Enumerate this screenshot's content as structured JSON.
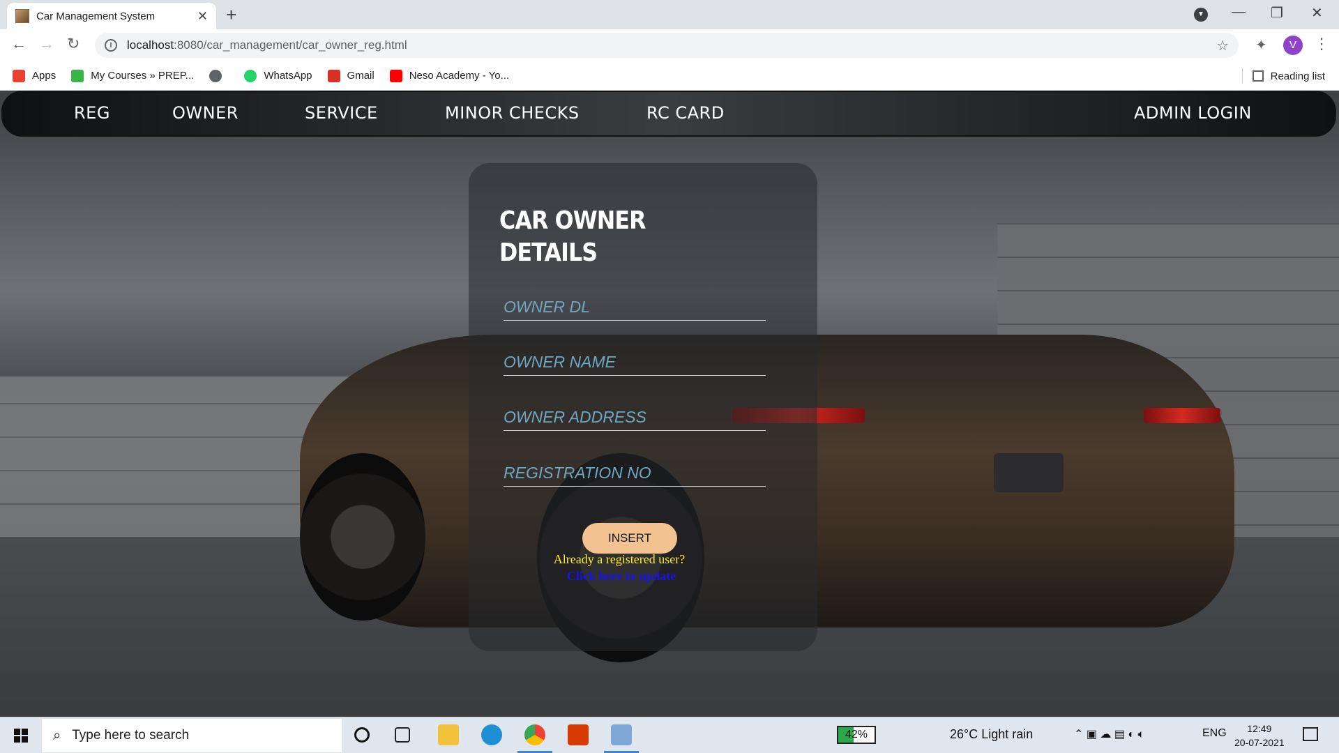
{
  "browser": {
    "tab_title": "Car Management System",
    "tab_close": "✕",
    "new_tab": "+",
    "url_host": "localhost",
    "url_path": ":8080/car_management/car_owner_reg.html",
    "bookmarks": [
      {
        "label": "Apps",
        "color": "#ea4335"
      },
      {
        "label": "My Courses » PREP...",
        "color": "#3bb54a"
      },
      {
        "label": "",
        "color": "#5f6368"
      },
      {
        "label": "WhatsApp",
        "color": "#25d366"
      },
      {
        "label": "Gmail",
        "color": "#d93025"
      },
      {
        "label": "Neso Academy - Yo...",
        "color": "#ff0000"
      }
    ],
    "reading_list": "Reading list",
    "avatar_letter": "V"
  },
  "nav": {
    "items": [
      "REG",
      "OWNER",
      "SERVICE",
      "MINOR CHECKS",
      "RC CARD"
    ],
    "admin": "ADMIN LOGIN"
  },
  "form": {
    "title_line1": "CAR OWNER",
    "title_line2": "DETAILS",
    "fields": [
      {
        "placeholder": "OWNER DL"
      },
      {
        "placeholder": "OWNER NAME"
      },
      {
        "placeholder": "OWNER ADDRESS"
      },
      {
        "placeholder": "REGISTRATION NO"
      }
    ],
    "insert_label": "INSERT",
    "already_text": "Already a registered user?",
    "update_link": "Click here to update"
  },
  "taskbar": {
    "search_placeholder": "Type here to search",
    "battery": "42%",
    "battery_level": 0.42,
    "weather": "26°C  Light rain",
    "lang": "ENG",
    "time": "12:49",
    "date": "20-07-2021"
  }
}
